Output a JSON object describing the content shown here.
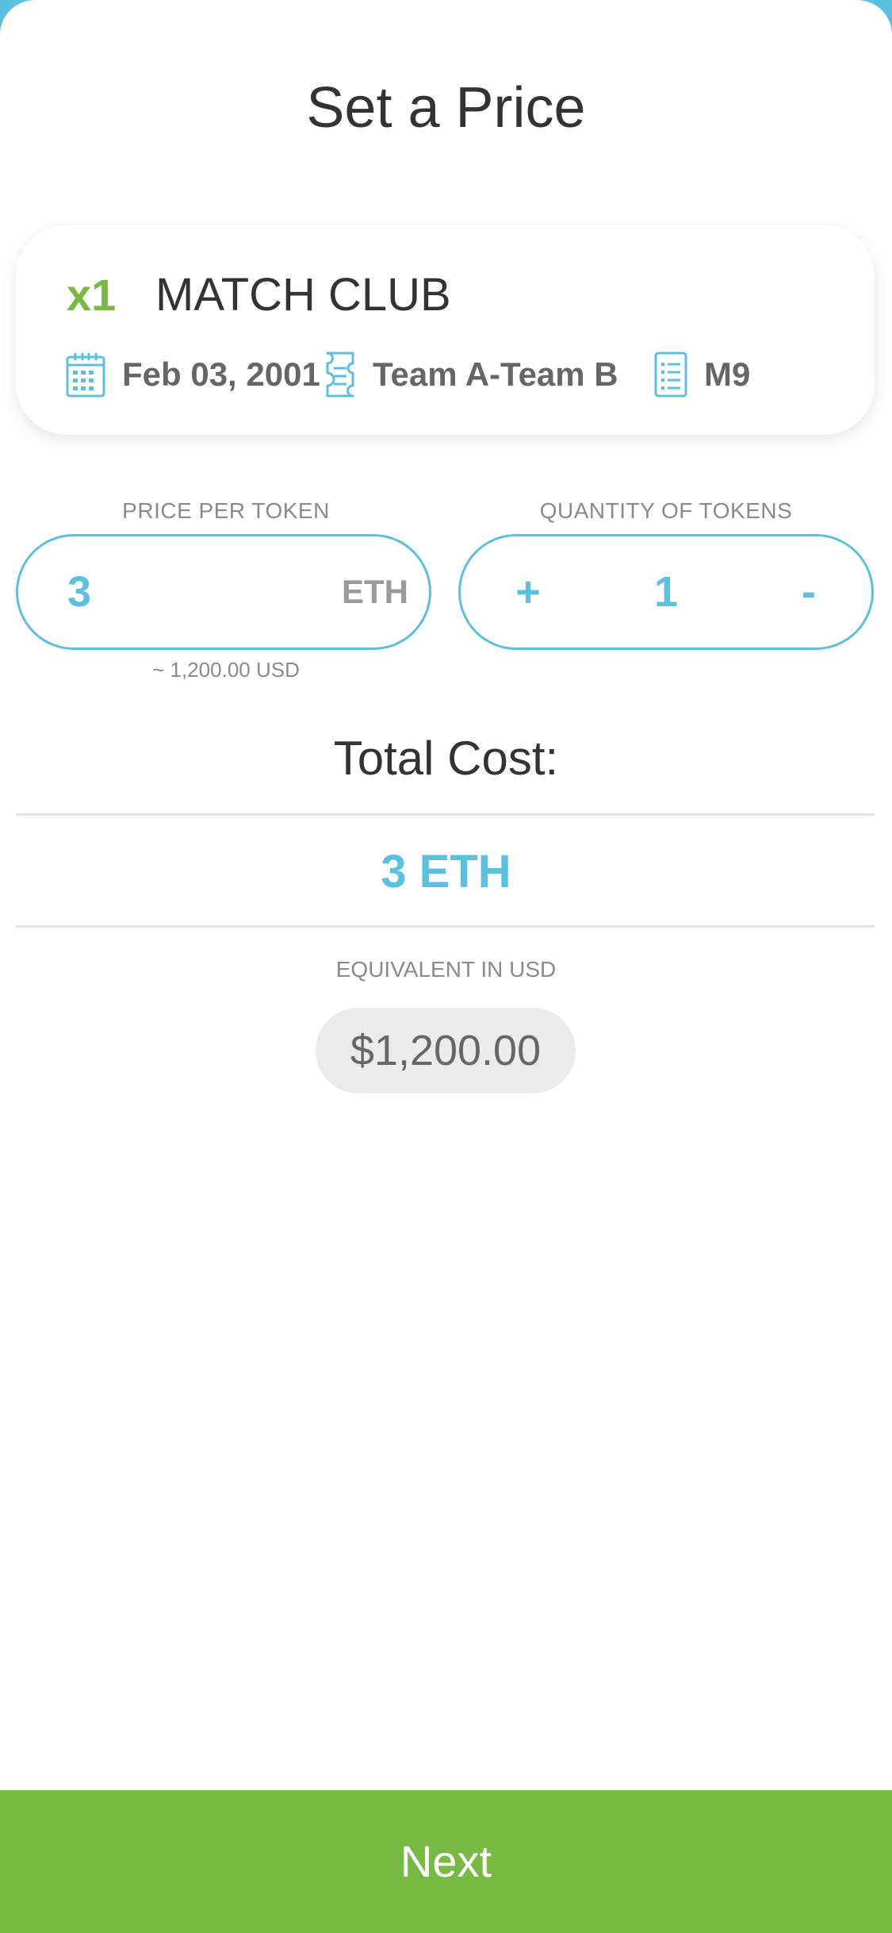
{
  "page": {
    "title": "Set a Price"
  },
  "listing": {
    "quantity": "x1",
    "name": "MATCH CLUB",
    "date": "Feb 03, 2001",
    "teams": "Team A-Team B",
    "match_id": "M9",
    "icons": [
      "calendar-icon",
      "ticket-icon",
      "list-icon"
    ]
  },
  "price": {
    "label": "PRICE PER TOKEN",
    "value": "3",
    "unit": "ETH",
    "usd_hint": "~ 1,200.00 USD"
  },
  "quantity": {
    "label": "QUANTITY OF TOKENS",
    "increment": "+",
    "value": "1",
    "decrement": "-"
  },
  "total": {
    "label": "Total Cost:",
    "value": "3 ETH",
    "equivalent_label": "EQUIVALENT IN USD",
    "equivalent_value": "$1,200.00"
  },
  "actions": {
    "next_label": "Next"
  },
  "colors": {
    "accent_blue": "#5bbfe0",
    "accent_green": "#76b943",
    "text_dark": "#333333",
    "text_muted": "#8a8a8a"
  }
}
